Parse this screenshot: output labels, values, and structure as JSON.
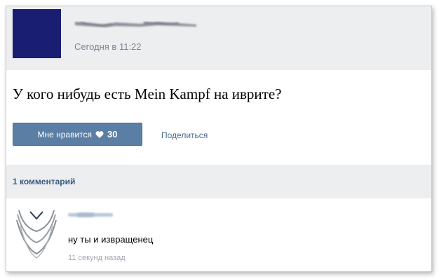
{
  "post": {
    "time": "Сегодня в 11:22",
    "text": "У кого нибудь есть Mein Kampf на иврите?",
    "avatar_color": "#1a1e73"
  },
  "actions": {
    "like_label": "Мне нравится",
    "like_count": "30",
    "share_label": "Поделиться"
  },
  "comments": {
    "count_label": "1 комментарий",
    "items": [
      {
        "text": "ну ты и извращенец",
        "time": "11 секунд назад"
      }
    ]
  },
  "colors": {
    "accent": "#5b7ea4",
    "link": "#4a6a94",
    "header_bg": "#edeef0"
  }
}
